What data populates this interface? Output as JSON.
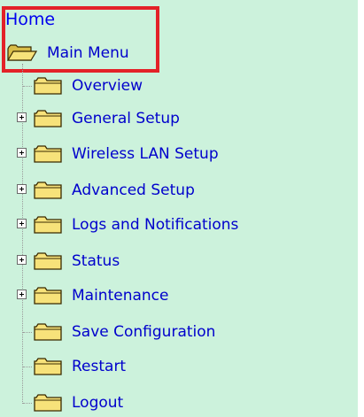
{
  "nav": {
    "home_label": "Home",
    "main_menu_label": "Main Menu",
    "items": [
      {
        "label": "Overview",
        "expandable": false
      },
      {
        "label": "General Setup",
        "expandable": true
      },
      {
        "label": "Wireless LAN Setup",
        "expandable": true
      },
      {
        "label": "Advanced Setup",
        "expandable": true
      },
      {
        "label": "Logs and Notifications",
        "expandable": true
      },
      {
        "label": "Status",
        "expandable": true
      },
      {
        "label": "Maintenance",
        "expandable": true
      },
      {
        "label": "Save Configuration",
        "expandable": false
      },
      {
        "label": "Restart",
        "expandable": false
      },
      {
        "label": "Logout",
        "expandable": false
      }
    ]
  },
  "colors": {
    "background": "#ccf2dc",
    "link": "#0000cc",
    "highlight_border": "#e32228",
    "folder_fill": "#f7e27a",
    "folder_outline": "#3a2a00"
  },
  "icons": {
    "folder": "folder-icon",
    "open_folder": "folder-open-icon",
    "expander": "plus-box-icon"
  }
}
